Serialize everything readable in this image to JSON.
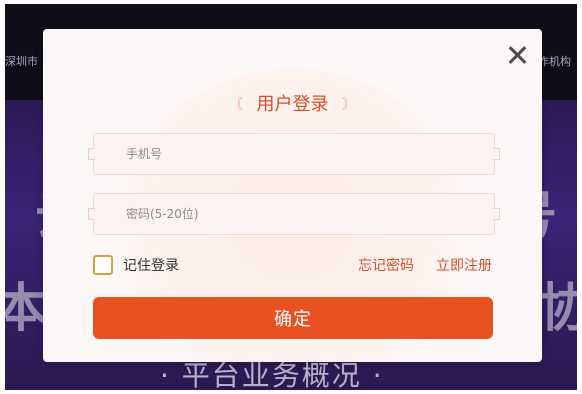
{
  "background": {
    "top_left_text": "深圳市",
    "top_right_text": "作机构",
    "big_left": "本",
    "big_right": "协",
    "big_mid_left": "云",
    "big_mid_right": "号",
    "footer_text": "· 平台业务概况 ·"
  },
  "modal": {
    "title": "用户登录",
    "title_deco_left": "〖",
    "title_deco_right": "〗",
    "phone_placeholder": "手机号",
    "password_placeholder": "密码(5-20位)",
    "remember_label": "记住登录",
    "forgot_password_link": "忘记密码",
    "register_link": "立即注册",
    "submit_label": "确定"
  }
}
